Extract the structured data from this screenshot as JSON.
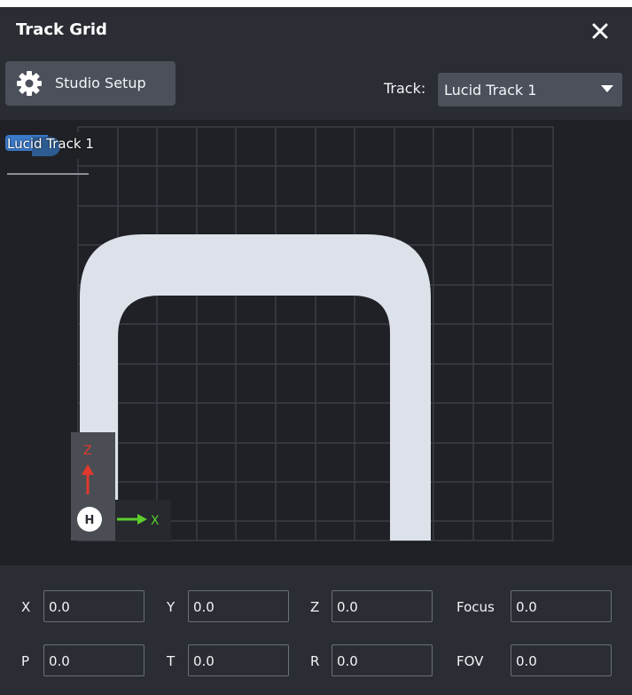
{
  "window": {
    "title": "Track Grid"
  },
  "toolbar": {
    "studio_setup_label": "Studio Setup",
    "track_label": "Track:",
    "track_selected": "Lucid Track 1"
  },
  "grid": {
    "track_tag": "Lucid Track 1",
    "axis_z_label": "Z",
    "axis_x_label": "X",
    "home_label": "H",
    "colors": {
      "track": "#dde1ea",
      "z_axis": "#e0382d",
      "x_axis": "#5ccd2c",
      "grid_line": "#3a3d44"
    }
  },
  "coords": {
    "row1": [
      {
        "label": "X",
        "value": "0.0"
      },
      {
        "label": "Y",
        "value": "0.0"
      },
      {
        "label": "Z",
        "value": "0.0"
      },
      {
        "label": "Focus",
        "value": "0.0"
      }
    ],
    "row2": [
      {
        "label": "P",
        "value": "0.0"
      },
      {
        "label": "T",
        "value": "0.0"
      },
      {
        "label": "R",
        "value": "0.0"
      },
      {
        "label": "FOV",
        "value": "0.0"
      }
    ]
  },
  "icons": {
    "close": "close-icon",
    "gear": "gear-icon",
    "caret": "chevron-down-icon"
  }
}
